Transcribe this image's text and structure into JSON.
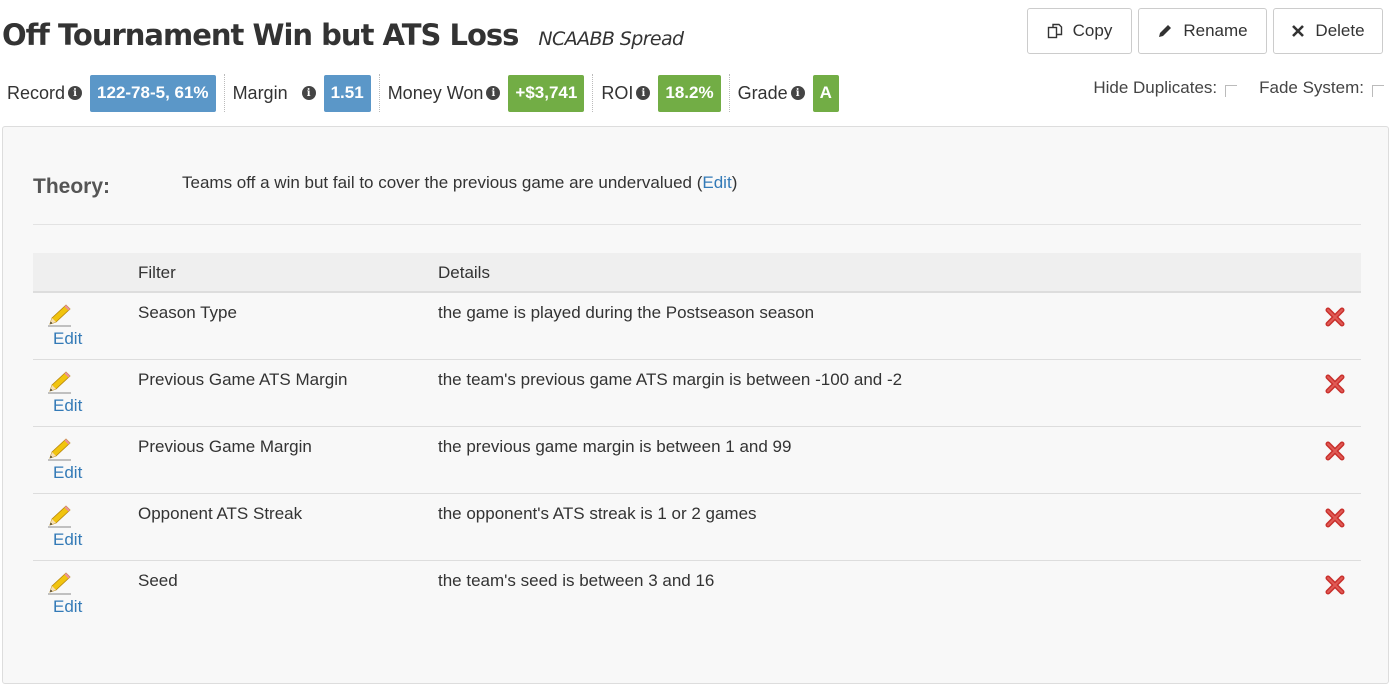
{
  "header": {
    "title": "Off Tournament Win but ATS Loss",
    "subtitle": "NCAABB Spread"
  },
  "actions": {
    "copy_label": "Copy",
    "rename_label": "Rename",
    "delete_label": "Delete"
  },
  "stats": {
    "record_label": "Record",
    "record_value": "122-78-5, 61%",
    "margin_label": "Margin",
    "margin_value": "1.51",
    "money_label": "Money Won",
    "money_value": "+$3,741",
    "roi_label": "ROI",
    "roi_value": "18.2%",
    "grade_label": "Grade",
    "grade_value": "A"
  },
  "toggles": {
    "hide_duplicates": "Hide Duplicates:",
    "fade_system": "Fade System:"
  },
  "theory": {
    "label": "Theory:",
    "text": "Teams off a win but fail to cover the previous game are undervalued",
    "edit_open": "(",
    "edit_label": "Edit",
    "edit_close": ")"
  },
  "table": {
    "headers": {
      "filter": "Filter",
      "details": "Details"
    },
    "edit_label": "Edit",
    "rows": [
      {
        "filter": "Season Type",
        "details": "the game is played during the Postseason season"
      },
      {
        "filter": "Previous Game ATS Margin",
        "details": "the team's previous game ATS margin is between -100 and -2"
      },
      {
        "filter": "Previous Game Margin",
        "details": "the previous game margin is between 1 and 99"
      },
      {
        "filter": "Opponent ATS Streak",
        "details": "the opponent's ATS streak is 1 or 2 games"
      },
      {
        "filter": "Seed",
        "details": "the team's seed is between 3 and 16"
      }
    ]
  },
  "colors": {
    "badge_blue": "#5b97c8",
    "badge_green": "#72ad45",
    "link": "#337ab7",
    "delete_red": "#c9302c"
  },
  "icons": {
    "copy": "copy-icon",
    "rename": "pencil-icon",
    "delete": "times-icon",
    "info": "info-icon",
    "row_edit": "pencil-icon",
    "row_delete": "red-x-icon"
  }
}
